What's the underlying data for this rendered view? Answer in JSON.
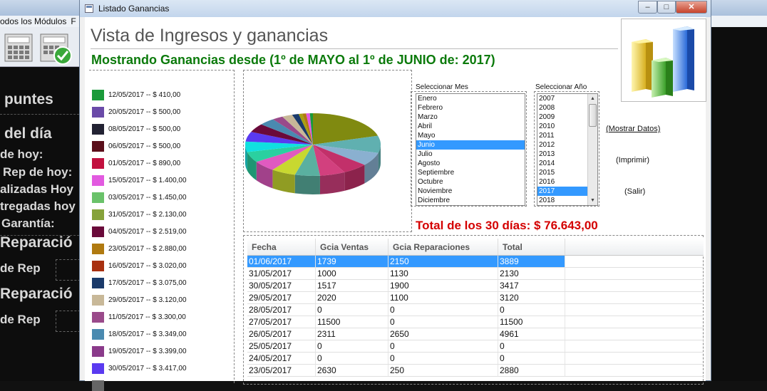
{
  "background": {
    "menu_text": "odos los Módulos",
    "menu_extra": "F",
    "labels": [
      "puntes",
      "del día",
      "de hoy:",
      "Rep de hoy:",
      "alizadas Hoy",
      "tregadas hoy",
      "Garantía:",
      "Reparació",
      "de Rep",
      "Reparació",
      "de Rep"
    ]
  },
  "window": {
    "title": "Listado Ganancias",
    "btn_minimize": "–",
    "btn_maximize": "□",
    "btn_close": "✕",
    "heading": "Vista de Ingresos y ganancias",
    "subheading": "Mostrando Ganancias desde (1º de MAYO al 1º de JUNIO de: 2017)"
  },
  "legend": [
    {
      "label": "12/05/2017 -- $ 410,00",
      "color": "#1a9a3a"
    },
    {
      "label": "20/05/2017 -- $ 500,00",
      "color": "#6a4aa8"
    },
    {
      "label": "08/05/2017 -- $ 500,00",
      "color": "#222233"
    },
    {
      "label": "06/05/2017 -- $ 500,00",
      "color": "#5a0e1a"
    },
    {
      "label": "01/05/2017 -- $ 890,00",
      "color": "#c2103e"
    },
    {
      "label": "15/05/2017 -- $ 1.400,00",
      "color": "#e25ae0"
    },
    {
      "label": "03/05/2017 -- $ 1.450,00",
      "color": "#6ac26a"
    },
    {
      "label": "31/05/2017 -- $ 2.130,00",
      "color": "#86a23a"
    },
    {
      "label": "04/05/2017 -- $ 2.519,00",
      "color": "#6a0a3a"
    },
    {
      "label": "23/05/2017 -- $ 2.880,00",
      "color": "#b07a10"
    },
    {
      "label": "16/05/2017 -- $ 3.020,00",
      "color": "#a83010"
    },
    {
      "label": "17/05/2017 -- $ 3.075,00",
      "color": "#1a3a6a"
    },
    {
      "label": "29/05/2017 -- $ 3.120,00",
      "color": "#c8b898"
    },
    {
      "label": "11/05/2017 -- $ 3.300,00",
      "color": "#9a4a8a"
    },
    {
      "label": "18/05/2017 -- $ 3.349,00",
      "color": "#4a8ab0"
    },
    {
      "label": "19/05/2017 -- $ 3.399,00",
      "color": "#8a3a8a"
    },
    {
      "label": "30/05/2017 -- $ 3.417,00",
      "color": "#5a3af0"
    }
  ],
  "selectors": {
    "month_label": "Seleccionar Mes",
    "months": [
      "Enero",
      "Febrero",
      "Marzo",
      "Abril",
      "Mayo",
      "Junio",
      "Julio",
      "Agosto",
      "Septiembre",
      "Octubre",
      "Noviembre",
      "Diciembre"
    ],
    "selected_month": "Junio",
    "year_label": "Seleccionar Año",
    "years": [
      "2007",
      "2008",
      "2009",
      "2010",
      "2011",
      "2012",
      "2013",
      "2014",
      "2015",
      "2016",
      "2017",
      "2018"
    ],
    "selected_year": "2017"
  },
  "actions": {
    "show_data": "(Mostrar Datos)",
    "print": "(Imprimir)",
    "exit": "(Salir)"
  },
  "total": "Total de los 30 días: $ 76.643,00",
  "table": {
    "columns": [
      "Fecha",
      "Gcia Ventas",
      "Gcia Reparaciones",
      "Total"
    ],
    "rows": [
      [
        "01/06/2017",
        "1739",
        "2150",
        "3889"
      ],
      [
        "31/05/2017",
        "1000",
        "1130",
        "2130"
      ],
      [
        "30/05/2017",
        "1517",
        "1900",
        "3417"
      ],
      [
        "29/05/2017",
        "2020",
        "1100",
        "3120"
      ],
      [
        "28/05/2017",
        "0",
        "0",
        "0"
      ],
      [
        "27/05/2017",
        "11500",
        "0",
        "11500"
      ],
      [
        "26/05/2017",
        "2311",
        "2650",
        "4961"
      ],
      [
        "25/05/2017",
        "0",
        "0",
        "0"
      ],
      [
        "24/05/2017",
        "0",
        "0",
        "0"
      ],
      [
        "23/05/2017",
        "2630",
        "250",
        "2880"
      ]
    ],
    "selected_row": 0
  },
  "pie_slices": [
    {
      "color": "#808a10",
      "value": 11500
    },
    {
      "color": "#60b0b0",
      "value": 4961
    },
    {
      "color": "#8ab0d0",
      "value": 3889
    },
    {
      "color": "#c2306a",
      "value": 3417
    },
    {
      "color": "#d2407e",
      "value": 3399
    },
    {
      "color": "#5ab0a0",
      "value": 3349
    },
    {
      "color": "#c8d830",
      "value": 3300
    },
    {
      "color": "#e05ac0",
      "value": 3120
    },
    {
      "color": "#2ad0a0",
      "value": 3075
    },
    {
      "color": "#10e0e0",
      "value": 3020
    },
    {
      "color": "#5a3af0",
      "value": 2880
    },
    {
      "color": "#6a0a3a",
      "value": 2519
    },
    {
      "color": "#4a8ab0",
      "value": 2130
    },
    {
      "color": "#9a4a8a",
      "value": 1450
    },
    {
      "color": "#c8b898",
      "value": 1400
    },
    {
      "color": "#1a3a6a",
      "value": 890
    },
    {
      "color": "#a8a010",
      "value": 500
    },
    {
      "color": "#b07a10",
      "value": 500
    },
    {
      "color": "#e25ae0",
      "value": 500
    },
    {
      "color": "#1a9a3a",
      "value": 410
    }
  ]
}
